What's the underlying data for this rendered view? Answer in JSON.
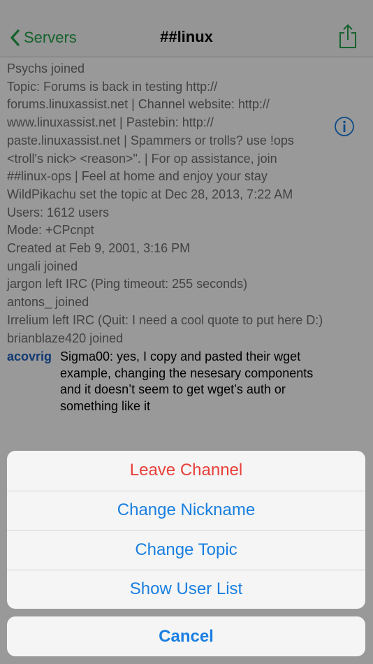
{
  "navbar": {
    "back_label": "Servers",
    "title": "##linux"
  },
  "log": [
    "Psychs joined",
    "Topic: Forums is back in testing http://",
    "forums.linuxassist.net | Channel website: http://",
    "www.linuxassist.net | Pastebin: http://",
    "paste.linuxassist.net | Spammers or trolls? use !ops",
    "<troll's nick> <reason>\". | For op assistance, join",
    "##linux-ops | Feel at home and enjoy your stay",
    "WildPikachu set the topic at Dec 28, 2013, 7:22 AM",
    "Users: 1612 users",
    "Mode: +CPcnpt",
    "Created at Feb 9, 2001, 3:16 PM",
    "ungali joined",
    "jargon left IRC (Ping timeout: 255 seconds)",
    "antons_ joined",
    "Irrelium left IRC (Quit: I need a cool quote to put here D:)",
    "brianblaze420 joined"
  ],
  "message": {
    "nick": "acovrig",
    "text": "Sigma00: yes, I copy and pasted their wget example, changing the nesesary components and it doesn’t seem to get wget’s auth or something like it"
  },
  "action_sheet": {
    "leave_label": "Leave Channel",
    "change_nickname_label": "Change Nickname",
    "change_topic_label": "Change Topic",
    "show_user_list_label": "Show User List",
    "cancel_label": "Cancel"
  },
  "icons": {
    "back": "chevron-left-icon",
    "share": "share-icon",
    "info": "info-icon"
  },
  "colors": {
    "accent_green": "#24a34a",
    "nick_blue": "#1f5fbd",
    "action_blue": "#1a7fe0",
    "destructive_red": "#e8403a"
  }
}
